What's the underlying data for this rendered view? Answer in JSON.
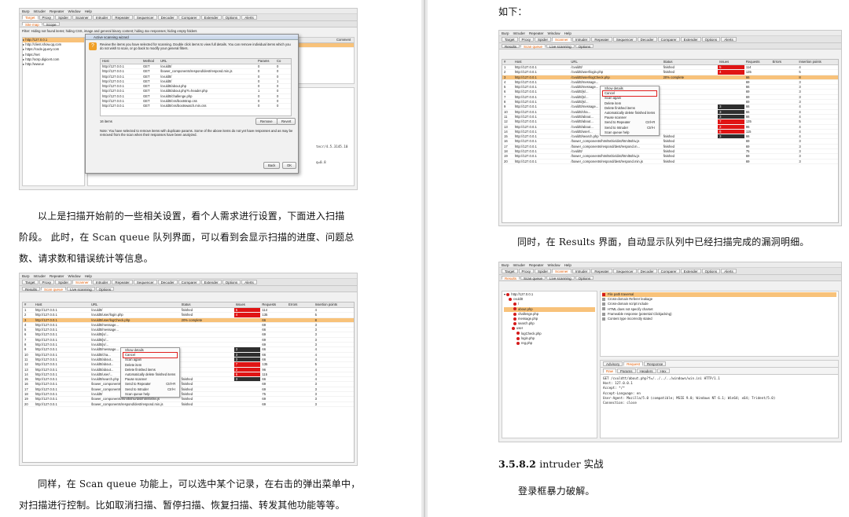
{
  "menu": [
    "Burp",
    "Intruder",
    "Repeater",
    "Window",
    "Help"
  ],
  "main_tabs": [
    "Target",
    "Proxy",
    "Spider",
    "Scanner",
    "Intruder",
    "Repeater",
    "Sequencer",
    "Decoder",
    "Comparer",
    "Extender",
    "Options",
    "Alerts"
  ],
  "scanner_tabs": [
    "Results",
    "Scan queue",
    "Live scanning",
    "Options"
  ],
  "target_subtabs": [
    "Site map",
    "Scope"
  ],
  "queue_columns": [
    "#",
    "Host",
    "URL",
    "Status",
    "Issues",
    "Requests",
    "Errors",
    "Insertion points"
  ],
  "queue_rows": [
    {
      "n": "1",
      "host": "http://127.0.0.1",
      "url": "/cvuldtt/",
      "status": "finished",
      "issues": "5",
      "requests": "114",
      "ins": "4",
      "ic": "red"
    },
    {
      "n": "2",
      "host": "http://127.0.0.1",
      "url": "/cvuldtt/user/login.php",
      "status": "finished",
      "issues": "4",
      "requests": "135",
      "ins": "5",
      "ic": "red"
    },
    {
      "n": "3",
      "host": "http://127.0.0.1",
      "url": "/cvuldtt/user/logCheck.php",
      "status": "20% complete",
      "issues": "",
      "requests": "66",
      "ins": "8",
      "ic": "",
      "sel": true
    },
    {
      "n": "4",
      "host": "http://127.0.0.1",
      "url": "/cvuldtt/message...",
      "status": "",
      "issues": "",
      "requests": "69",
      "ins": "3",
      "ic": ""
    },
    {
      "n": "5",
      "host": "http://127.0.0.1",
      "url": "/cvuldtt/message...",
      "status": "",
      "issues": "",
      "requests": "66",
      "ins": "3",
      "ic": ""
    },
    {
      "n": "6",
      "host": "http://127.0.0.1",
      "url": "/cvuldtt/js/...",
      "status": "",
      "issues": "",
      "requests": "69",
      "ins": "3",
      "ic": ""
    },
    {
      "n": "7",
      "host": "http://127.0.0.1",
      "url": "/cvuldtt/js/...",
      "status": "",
      "issues": "",
      "requests": "69",
      "ins": "3",
      "ic": ""
    },
    {
      "n": "8",
      "host": "http://127.0.0.1",
      "url": "/cvuldtt/js/...",
      "status": "",
      "issues": "",
      "requests": "69",
      "ins": "3",
      "ic": ""
    },
    {
      "n": "9",
      "host": "http://127.0.0.1",
      "url": "/cvuldtt/message...",
      "status": "",
      "issues": "3",
      "requests": "66",
      "ins": "4",
      "ic": "dark"
    },
    {
      "n": "10",
      "host": "http://127.0.0.1",
      "url": "/cvuldtt/cha...",
      "status": "",
      "issues": "3",
      "requests": "66",
      "ins": "4",
      "ic": "dark"
    },
    {
      "n": "11",
      "host": "http://127.0.0.1",
      "url": "/cvuldtt/about...",
      "status": "",
      "issues": "3",
      "requests": "66",
      "ins": "4",
      "ic": "dark"
    },
    {
      "n": "12",
      "host": "http://127.0.0.1",
      "url": "/cvuldtt/about...",
      "status": "",
      "issues": "7",
      "requests": "135",
      "ins": "5",
      "ic": "red"
    },
    {
      "n": "13",
      "host": "http://127.0.0.1",
      "url": "/cvuldtt/about...",
      "status": "",
      "issues": "2",
      "requests": "96",
      "ins": "4",
      "ic": "red"
    },
    {
      "n": "14",
      "host": "http://127.0.0.1",
      "url": "/cvuldtt/user/...",
      "status": "",
      "issues": "6",
      "requests": "115",
      "ins": "4",
      "ic": "red"
    },
    {
      "n": "15",
      "host": "http://127.0.0.1",
      "url": "/cvuldtt/search.php",
      "status": "finished",
      "issues": "3",
      "requests": "66",
      "ins": "4",
      "ic": "dark"
    },
    {
      "n": "16",
      "host": "http://127.0.0.1",
      "url": "/bower_components/html5shiv/dist/html5shiv.js",
      "status": "finished",
      "issues": "",
      "requests": "69",
      "ins": "3",
      "ic": ""
    },
    {
      "n": "17",
      "host": "http://127.0.0.1",
      "url": "/bower_components/respond/dest/respond.m...",
      "status": "finished",
      "issues": "",
      "requests": "69",
      "ins": "3",
      "ic": ""
    },
    {
      "n": "18",
      "host": "http://127.0.0.1",
      "url": "/cvuldtt/",
      "status": "finished",
      "issues": "",
      "requests": "75",
      "ins": "3",
      "ic": ""
    },
    {
      "n": "19",
      "host": "http://127.0.0.1",
      "url": "/bower_components/html5shiv/dist/html5shiv.js",
      "status": "finished",
      "issues": "",
      "requests": "69",
      "ins": "3",
      "ic": ""
    },
    {
      "n": "20",
      "host": "http://127.0.0.1",
      "url": "/bower_components/respond/dest/respond.min.js",
      "status": "finished",
      "issues": "",
      "requests": "69",
      "ins": "3",
      "ic": ""
    }
  ],
  "context_menu": [
    {
      "label": "Show details",
      "key": ""
    },
    {
      "label": "Cancel",
      "key": "",
      "hl": true
    },
    {
      "label": "Scan again",
      "key": ""
    },
    {
      "label": "Delete item",
      "key": ""
    },
    {
      "label": "Delete finished items",
      "key": ""
    },
    {
      "label": "Automatically delete finished items",
      "key": ""
    },
    {
      "label": "Pause scanner",
      "key": ""
    },
    {
      "label": "Send to Repeater",
      "key": "Ctrl+R"
    },
    {
      "label": "Send to Intruder",
      "key": "Ctrl+I"
    },
    {
      "label": "Scan queue help",
      "key": ""
    }
  ],
  "wizard": {
    "title": "Active scanning wizard",
    "intro": "Review the items you have selected for scanning. Double click items to view full details. You can remove individual items which you do not wish to scan, or go back to modify your general filters.",
    "columns": [
      "Host",
      "Method",
      "URL",
      "Params",
      "Co"
    ],
    "rows": [
      [
        "http://127.0.0.1",
        "GET",
        "/cvuldtt/",
        "0",
        "0"
      ],
      [
        "http://127.0.0.1",
        "GET",
        "/bower_components/respond/dest/respond.min.js",
        "0",
        "0"
      ],
      [
        "http://127.0.0.1",
        "GET",
        "/cvuldtt/",
        "0",
        "0"
      ],
      [
        "http://127.0.0.1",
        "GET",
        "/cvuldtt/",
        "0",
        "1"
      ],
      [
        "http://127.0.0.1",
        "GET",
        "/cvuldtt/about.php",
        "0",
        "0"
      ],
      [
        "http://127.0.0.1",
        "GET",
        "/cvuldtt/about.php?t=header.php",
        "1",
        "0"
      ],
      [
        "http://127.0.0.1",
        "GET",
        "/cvuldtt/challenge.php",
        "0",
        "0"
      ],
      [
        "http://127.0.0.1",
        "GET",
        "/cvuldtt/css/bootstrap.css",
        "0",
        "0"
      ],
      [
        "http://127.0.0.1",
        "GET",
        "/cvuldtt/css/bootswatch.min.css",
        "0",
        "0"
      ]
    ],
    "count": "16 items",
    "remove": "Remove",
    "revert": "Revert",
    "note": "Note: You have selected to remove items with duplicate params. Some of the above items do not yet have responses and as may be removed from the scan when their responses have been analyzed.",
    "back": "Back",
    "ok": "OK"
  },
  "sitemap_filter": "Filter: Hiding not found items; hiding CSS, image and general binary content; hiding 4xx responses; hiding empty folders",
  "sitemap_items": [
    "http://127.0.0.1",
    "http://client.show.qq.com",
    "https://code.jquery.com",
    "https://net",
    "http://ocsp.digicert.com",
    "http://www.w"
  ],
  "sitemap_right_label": "Comment",
  "console_hint": "Accept-Language: zh",
  "results_tree": {
    "root": "http://127.0.0.1",
    "items": [
      "cvuldtt",
      "/",
      "about.php",
      "challenge.php",
      "message.php",
      "search.php",
      "user",
      "logCheck.php",
      "login.php",
      "reg.php"
    ]
  },
  "issues": [
    "File path traversal",
    "Cross-domain Referer leakage",
    "Cross-domain script include",
    "HTML does not specify charset",
    "Frameable response (potential Clickjacking)",
    "Content type incorrectly stated"
  ],
  "req_tabs": [
    "Advisory",
    "Request",
    "Response"
  ],
  "raw_tabs": [
    "Raw",
    "Params",
    "Headers",
    "Hex"
  ],
  "request_lines": [
    "GET /cvuldtt/about.php?f=/../../../windows/win.ini HTTP/1.1",
    "Host: 127.0.0.1",
    "Accept: */*",
    "Accept-Language: en",
    "User-Agent: Mozilla/5.0 (compatible; MSIE 9.0; Windows NT 6.1; Win64; x64; Trident/5.0)",
    "Connection: close"
  ],
  "text": {
    "left_p1_line1": "以上是扫描开始前的一些相关设置，看个人需求进行设置，下面进入扫描",
    "left_p1_line2": "阶段。 此时，在 Scan queue 队列界面，可以看到会显示扫描的进度、问题总",
    "left_p1_line3": "数、请求数和错误统计等信息。",
    "left_p2_line1": "同样，在 Scan queue 功能上，可以选中某个记录，在右击的弹出菜单中，",
    "left_p2_line2": "对扫描进行控制。比如取消扫描、暂停扫描、恢复扫描、转发其他功能等等。",
    "right_top": "如下：",
    "right_p1": "同时，在 Results 界面，自动显示队列中已经扫描完成的漏洞明细。",
    "heading_num": "3.5.8.2",
    "heading_title": "intruder 实战",
    "right_p2": "登录框暴力破解。"
  }
}
